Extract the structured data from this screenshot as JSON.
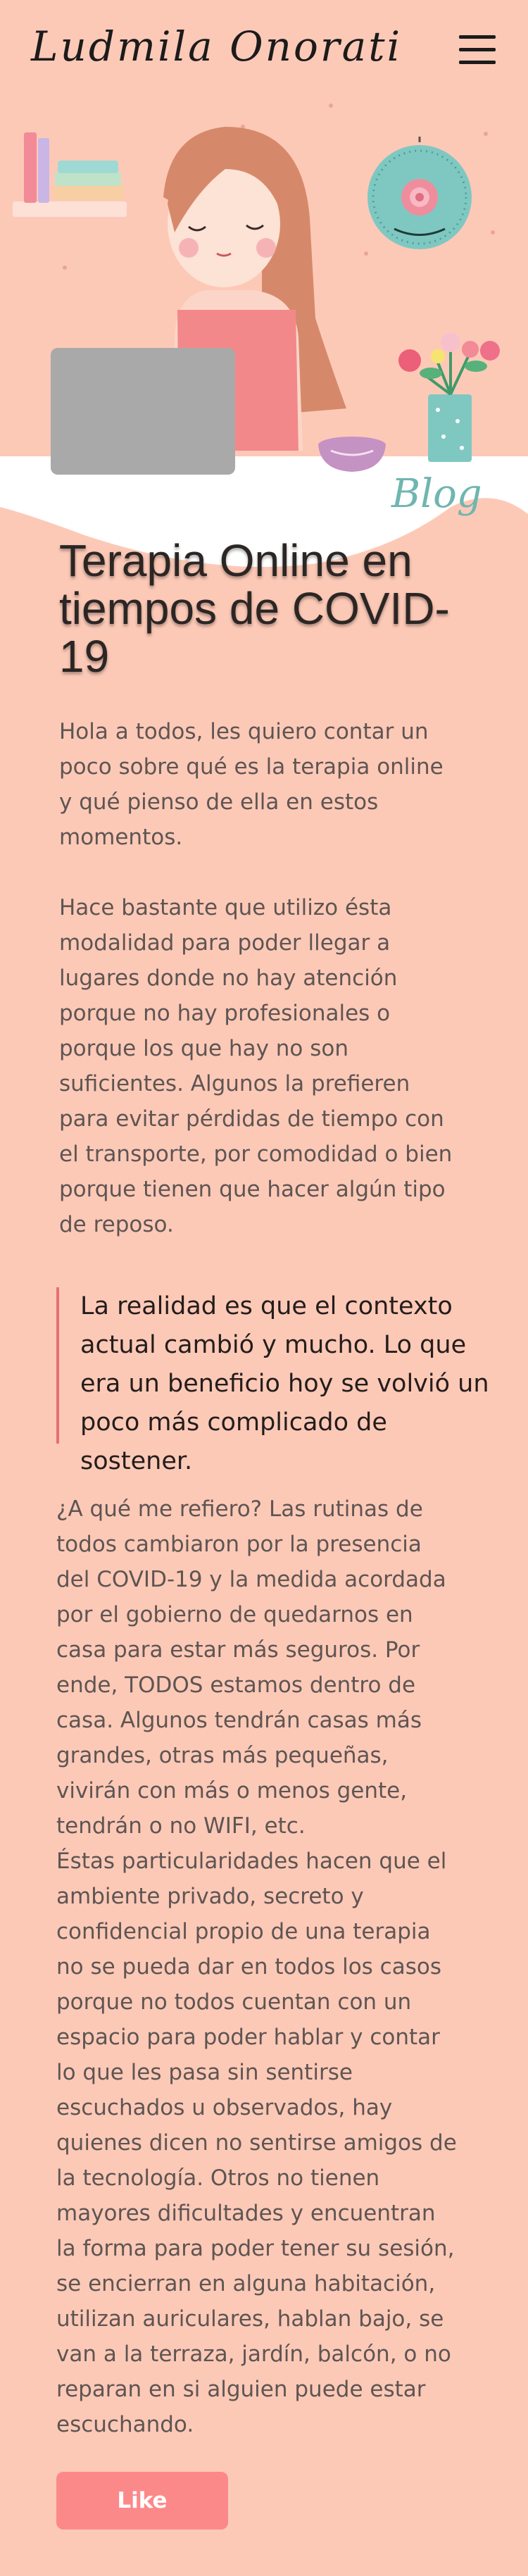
{
  "header": {
    "logo_text": "Ludmila Onorati"
  },
  "hero": {
    "blog_label": "Blog"
  },
  "article": {
    "title": "Terapia Online en tiempos de COVID-19",
    "paragraphs": [
      "Hola a todos, les quiero contar un poco sobre qué es la terapia online y qué pienso de ella en estos momentos.",
      "Hace bastante que utilizo ésta modalidad para poder llegar a lugares donde no hay atención porque no hay profesionales o porque los que hay no son suficientes. Algunos la prefieren para evitar pérdidas de tiempo con el transporte, por comodidad o bien porque tienen que hacer algún tipo de reposo.",
      "¿A qué me refiero? Las rutinas de todos cambiaron por la presencia del COVID-19 y la medida acordada por el gobierno de quedarnos en casa para estar más seguros. Por ende, TODOS estamos dentro de casa. Algunos tendrán casas más grandes, otras más pequeñas, vivirán con más o menos gente, tendrán o no WIFI, etc.",
      "Éstas particularidades hacen que el ambiente privado, secreto y confidencial propio de una terapia no se pueda dar en todos los casos porque no todos cuentan con un espacio para poder hablar y contar lo que les pasa sin sentirse escuchados u observados, hay quienes dicen no sentirse amigos de la tecnología. Otros no tienen mayores dificultades y encuentran la forma para poder tener su sesión, se encierran en alguna habitación, utilizan auriculares, hablan bajo, se van a la terraza, jardín, balcón, o no reparan en si alguien puede estar escuchando."
    ],
    "quote": "La realidad es que el contexto actual cambió y mucho. Lo que era un beneficio hoy se volvió un poco más complicado de sostener.",
    "like_label": "Like"
  },
  "colors": {
    "background": "#fdc9b7",
    "accent": "#fc898a",
    "quote_border": "#e96f73",
    "title": "#2b2624",
    "text": "#5e5553"
  },
  "icons": [
    "menu-icon",
    "books-icon",
    "wall-clock-icon",
    "laptop-icon",
    "teacup-icon",
    "flower-vase-icon"
  ]
}
